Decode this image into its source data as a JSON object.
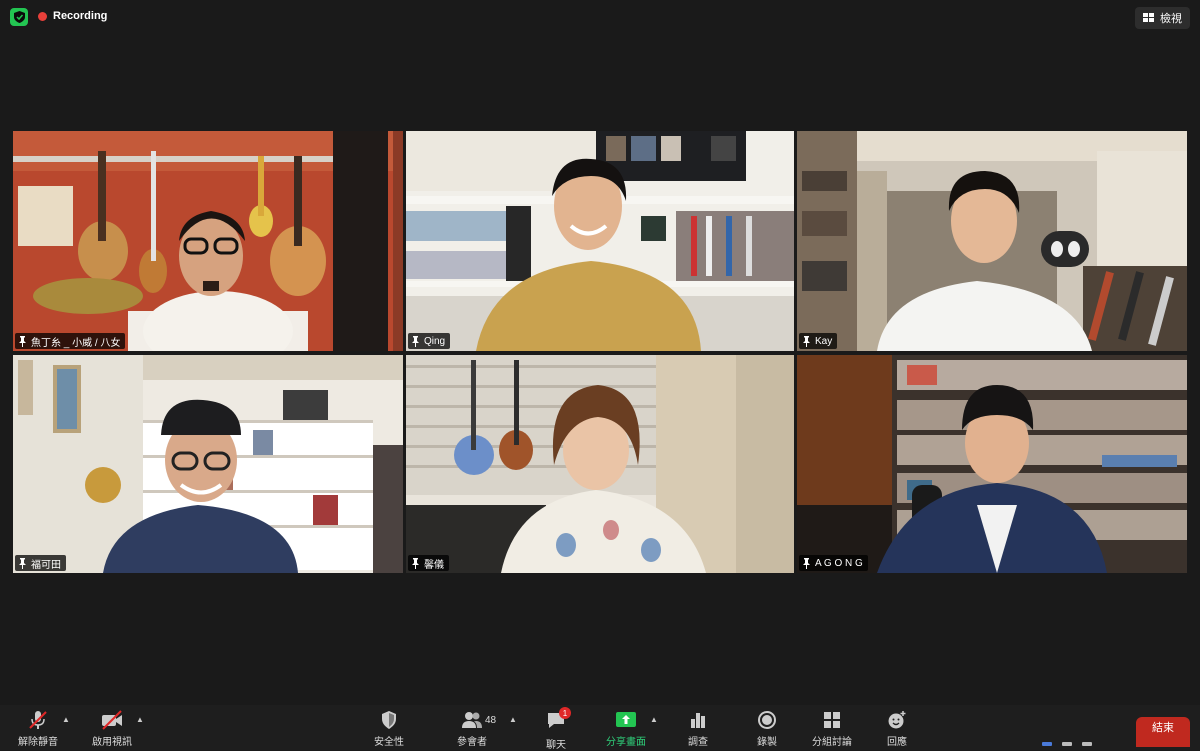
{
  "top": {
    "recording": "Recording",
    "view_label": "檢視"
  },
  "participants": [
    {
      "name": "魚丁糸 _ 小威 / 八女"
    },
    {
      "name": "Qing"
    },
    {
      "name": "Kay"
    },
    {
      "name": "福可田"
    },
    {
      "name": "馨儀"
    },
    {
      "name": "A G O N G"
    }
  ],
  "toolbar": {
    "mute": "解除靜音",
    "video": "啟用視訊",
    "security": "安全性",
    "participants": "參會者",
    "participants_count": "48",
    "chat": "聊天",
    "chat_badge": "1",
    "share": "分享畫面",
    "polls": "調查",
    "record": "錄製",
    "breakout": "分組討論",
    "reactions": "回應",
    "end": "結束"
  },
  "colors": {
    "accent_green": "#23c552",
    "speaker_border": "#ece88c",
    "end_red": "#c0291f"
  }
}
